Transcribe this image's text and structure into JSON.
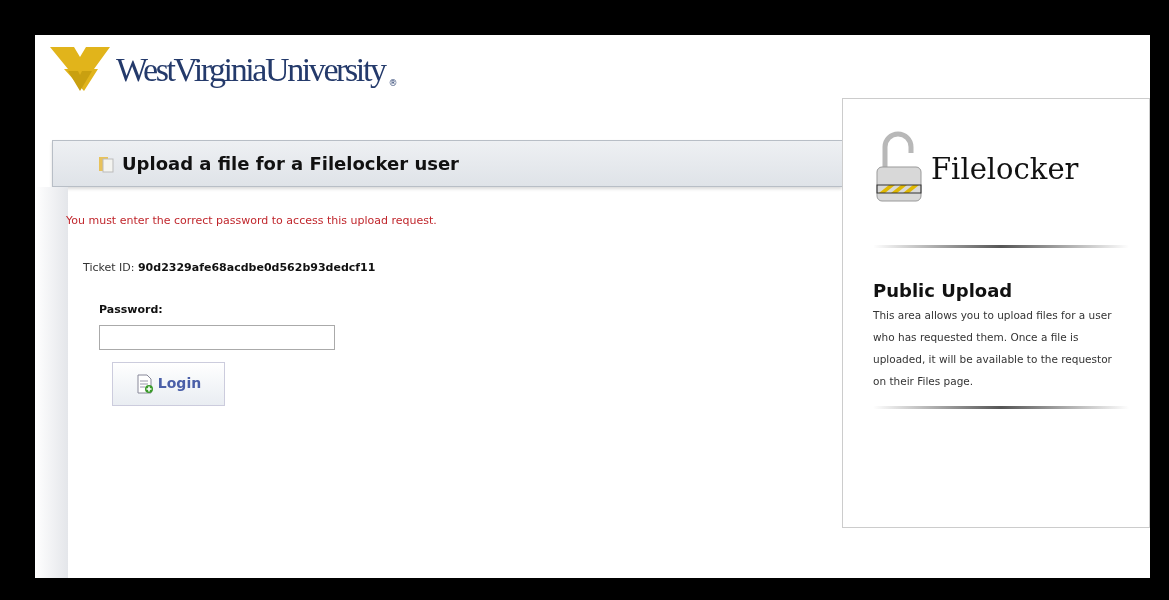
{
  "logo": {
    "text": "WestVirginiaUniversity",
    "registered_mark": "®"
  },
  "page_header": {
    "title": "Upload a file for a Filelocker user"
  },
  "error_message": "You must enter the correct password to access this upload request.",
  "ticket": {
    "label": "Ticket ID:",
    "value": "90d2329afe68acdbe0d562b93dedcf11"
  },
  "password_field": {
    "label": "Password:"
  },
  "buttons": [
    {
      "label": "Login"
    }
  ],
  "sidebar": {
    "brand": "Filelocker",
    "heading": "Public Upload",
    "text": "This area allows you to upload files for a user who has requested them. Once a file is uploaded, it will be available to the requestor on their Files page."
  }
}
